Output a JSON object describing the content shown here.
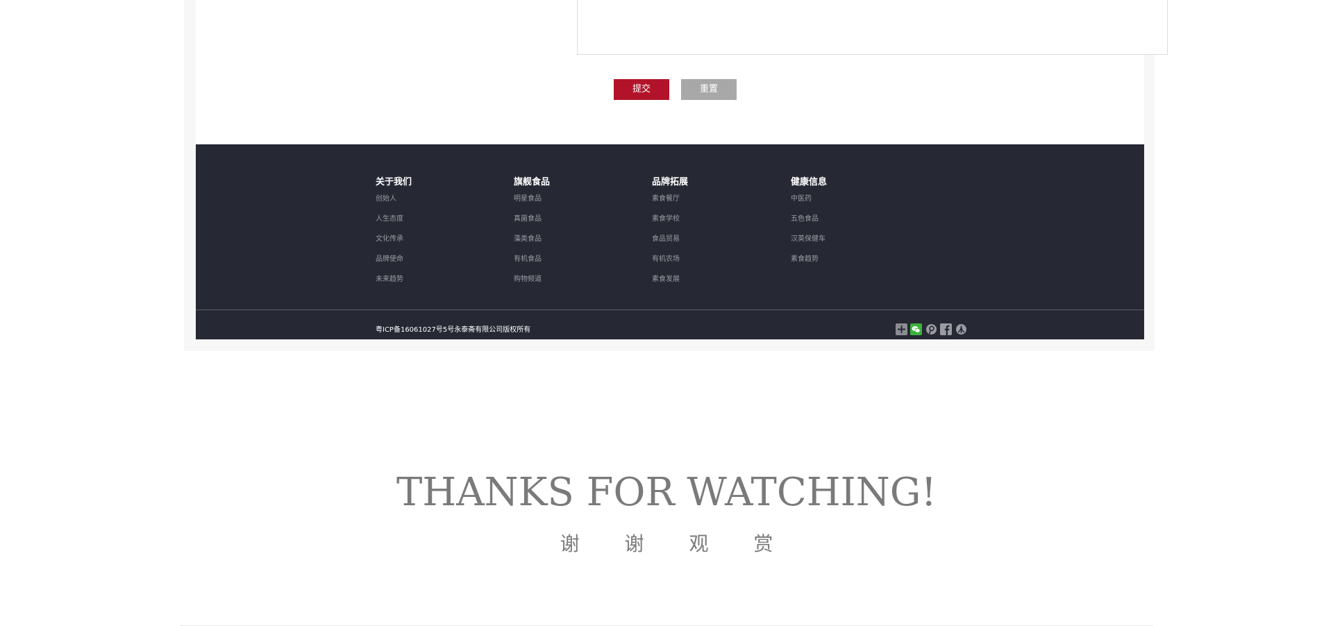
{
  "form": {
    "submit_label": "提交",
    "reset_label": "重置"
  },
  "footer": {
    "columns": [
      {
        "title": "关于我们",
        "items": [
          "创始人",
          "人生态度",
          "文化传承",
          "品牌使命",
          "未来趋势"
        ]
      },
      {
        "title": "旗舰食品",
        "items": [
          "明星食品",
          "真菌食品",
          "藻类食品",
          "有机食品",
          "购物频道"
        ]
      },
      {
        "title": "品牌拓展",
        "items": [
          "素食餐厅",
          "素食学校",
          "食品贸易",
          "有机农场",
          "素食发展"
        ]
      },
      {
        "title": "健康信息",
        "items": [
          "中医药",
          "五色食品",
          "汉英保健车",
          "素食趋势"
        ]
      }
    ],
    "copyright": "粤ICP备16061027号5号永泰斋有限公司版权所有",
    "social_icons": [
      "share-plus-icon",
      "wechat-icon",
      "pinterest-icon",
      "facebook-icon",
      "renren-icon"
    ]
  },
  "closing": {
    "title": "THANKS FOR WATCHING!",
    "subtitle_chars": [
      "谢",
      "谢",
      "观",
      "赏"
    ]
  },
  "colors": {
    "submit": "#b2132a",
    "reset": "#a8a8a8",
    "footer_bg": "#262833",
    "wechat": "#3bb13d"
  }
}
